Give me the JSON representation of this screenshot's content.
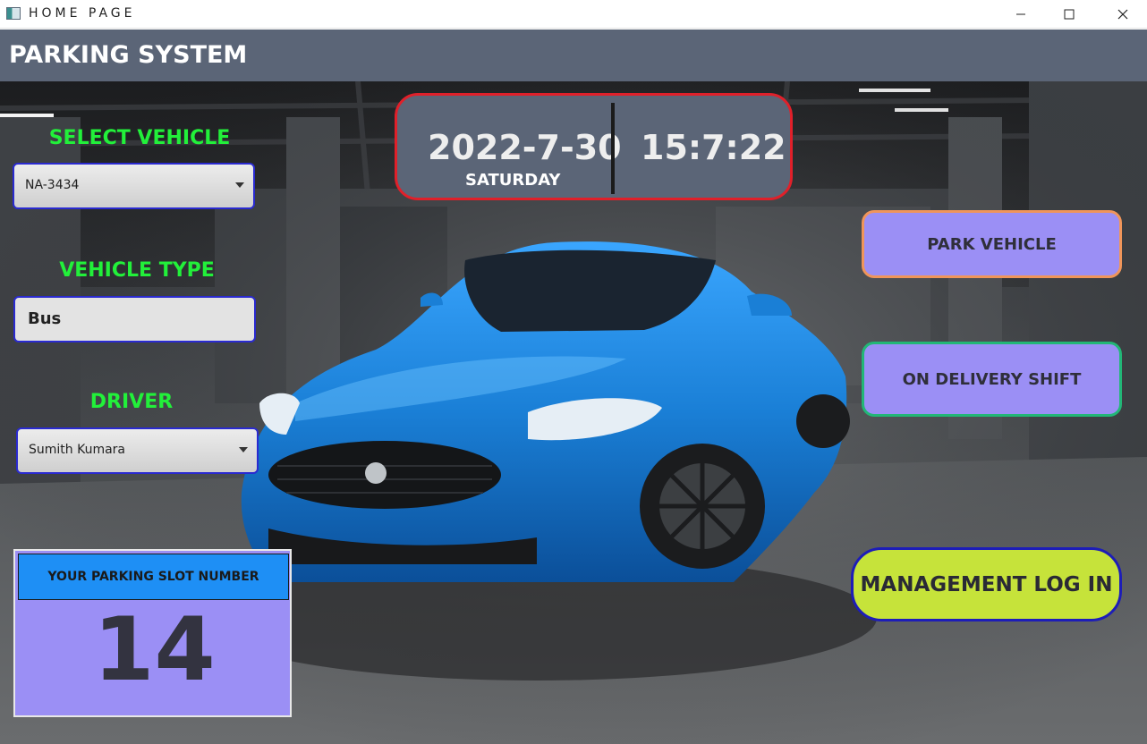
{
  "window": {
    "title": "HOME PAGE",
    "controls": {
      "minimize": "minimize-icon",
      "maximize": "maximize-icon",
      "close": "close-icon"
    }
  },
  "header": {
    "title": "PARKING SYSTEM"
  },
  "left_panel": {
    "select_vehicle": {
      "label": "SELECT VEHICLE",
      "value": "NA-3434"
    },
    "vehicle_type": {
      "label": "VEHICLE TYPE",
      "value": "Bus"
    },
    "driver": {
      "label": "DRIVER",
      "value": "Sumith Kumara"
    }
  },
  "datetime": {
    "date": "2022-7-30",
    "day": "SATURDAY",
    "time": "15:7:22"
  },
  "buttons": {
    "park": "PARK VEHICLE",
    "delivery": "ON DELIVERY SHIFT",
    "management": "MANAGEMENT LOG IN"
  },
  "slot": {
    "heading": "YOUR PARKING SLOT NUMBER",
    "number": "14"
  },
  "colors": {
    "header_bg": "#5b6577",
    "label_green": "#22f03a",
    "button_purple": "#9b8ff5",
    "button_lime": "#c6e33a",
    "slot_header_blue": "#1e8ff5",
    "datetime_border": "#e0202a",
    "car_blue": "#1a7fd6"
  }
}
